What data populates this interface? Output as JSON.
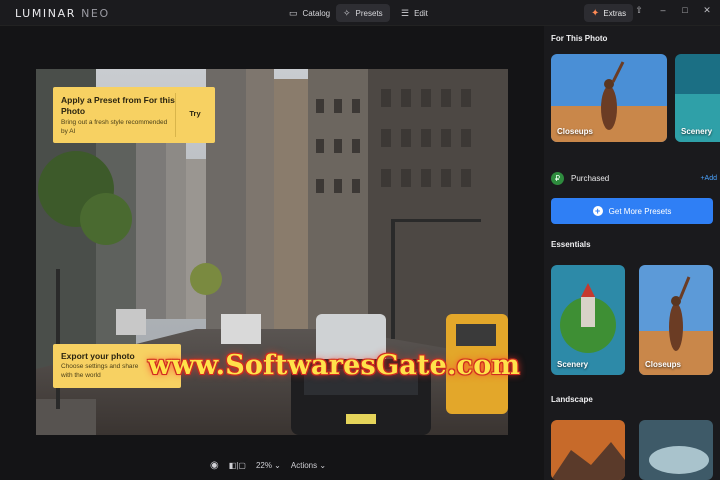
{
  "app": {
    "logo_main": "LUMINAR",
    "logo_sub": "NEO"
  },
  "topbar": {
    "tabs": [
      {
        "label": "Catalog",
        "icon": "folder-icon"
      },
      {
        "label": "Presets",
        "icon": "sparkle-icon"
      },
      {
        "label": "Edit",
        "icon": "sliders-icon"
      }
    ],
    "active_tab": "Presets",
    "extras_label": "Extras",
    "extras_color": "#ff8a55"
  },
  "tips": {
    "apply_title": "Apply a Preset from For this Photo",
    "apply_body": "Bring out a fresh style recommended by AI",
    "apply_action": "Try",
    "export_title": "Export your photo",
    "export_body": "Choose settings and share with the world"
  },
  "watermark": "www.SoftwaresGate.com",
  "bottombar": {
    "zoom": "22%",
    "actions_label": "Actions"
  },
  "panel": {
    "for_this_photo_title": "For This Photo",
    "for_this_photo_cards": [
      "Closeups",
      "Scenery"
    ],
    "purchased_label": "Purchased",
    "purchased_add": "+Add",
    "get_more_label": "Get More Presets",
    "accent_color": "#2f7ff5",
    "essentials_title": "Essentials",
    "essentials_cards": [
      "Scenery",
      "Closeups"
    ],
    "landscape_title": "Landscape"
  }
}
